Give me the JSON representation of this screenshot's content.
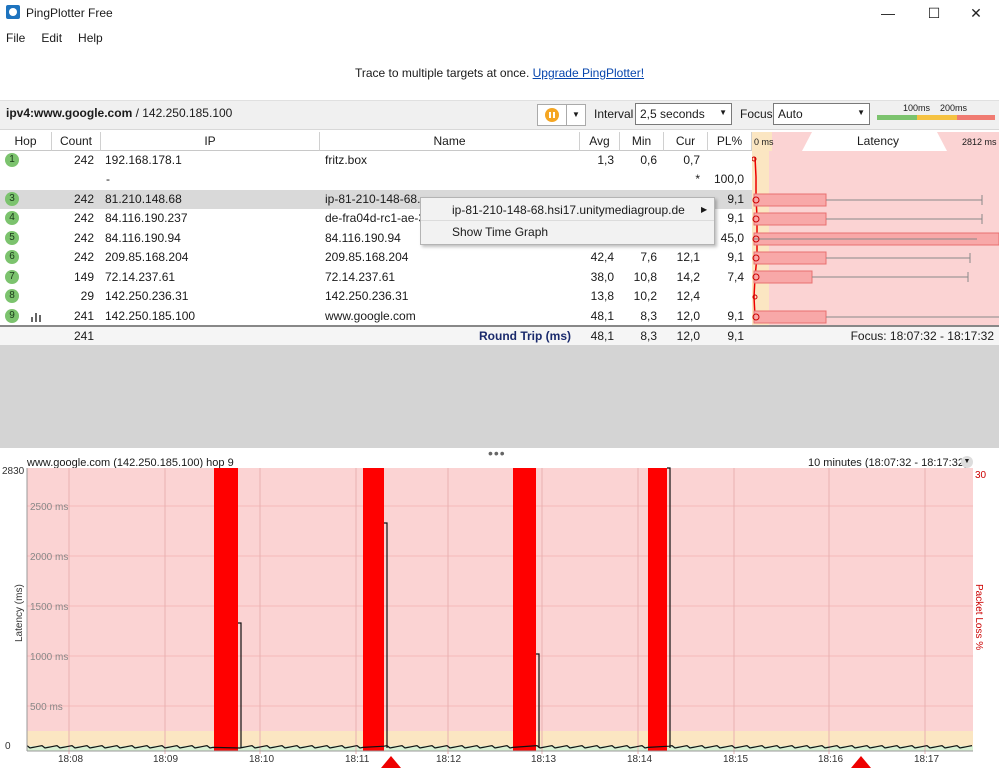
{
  "window": {
    "title": "PingPlotter Free",
    "minimize": "—",
    "maximize": "☐",
    "close": "✕"
  },
  "menu": [
    "File",
    "Edit",
    "Help"
  ],
  "promo": {
    "text": "Trace to multiple targets at once.",
    "link": "Upgrade PingPlotter!"
  },
  "toolbar": {
    "target_host": "ipv4:www.google.com",
    "target_sep": " / ",
    "target_ip": "142.250.185.100",
    "interval_label": "Interval",
    "interval_value": "2,5 seconds",
    "focus_label": "Focus",
    "focus_value": "Auto",
    "scale_100": "100ms",
    "scale_200": "200ms"
  },
  "columns": {
    "hop": "Hop",
    "count": "Count",
    "ip": "IP",
    "name": "Name",
    "avg": "Avg",
    "min": "Min",
    "cur": "Cur",
    "pl": "PL%",
    "lat_min": "0 ms",
    "latency": "Latency",
    "lat_max": "2812 ms"
  },
  "hops": [
    {
      "hop": "1",
      "count": "242",
      "ip": "192.168.178.1",
      "name": "fritz.box",
      "avg": "1,3",
      "min": "0,6",
      "cur": "0,7",
      "pl": ""
    },
    {
      "hop": "",
      "count": "-",
      "ip": "",
      "name": "",
      "avg": "",
      "min": "",
      "cur": "*",
      "pl": "100,0"
    },
    {
      "hop": "3",
      "count": "242",
      "ip": "81.210.148.68",
      "name": "ip-81-210-148-68.",
      "avg": "",
      "min": "",
      "cur": "",
      "pl": "9,1"
    },
    {
      "hop": "4",
      "count": "242",
      "ip": "84.116.190.237",
      "name": "de-fra04d-rc1-ae-3",
      "avg": "",
      "min": "",
      "cur": "",
      "pl": "9,1"
    },
    {
      "hop": "5",
      "count": "242",
      "ip": "84.116.190.94",
      "name": "84.116.190.94",
      "avg": "",
      "min": "",
      "cur": "",
      "pl": "45,0"
    },
    {
      "hop": "6",
      "count": "242",
      "ip": "209.85.168.204",
      "name": "209.85.168.204",
      "avg": "42,4",
      "min": "7,6",
      "cur": "12,1",
      "pl": "9,1"
    },
    {
      "hop": "7",
      "count": "149",
      "ip": "72.14.237.61",
      "name": "72.14.237.61",
      "avg": "38,0",
      "min": "10,8",
      "cur": "14,2",
      "pl": "7,4"
    },
    {
      "hop": "8",
      "count": "29",
      "ip": "142.250.236.31",
      "name": "142.250.236.31",
      "avg": "13,8",
      "min": "10,2",
      "cur": "12,4",
      "pl": ""
    },
    {
      "hop": "9",
      "count": "241",
      "ip": "142.250.185.100",
      "name": "www.google.com",
      "avg": "48,1",
      "min": "8,3",
      "cur": "12,0",
      "pl": "9,1"
    }
  ],
  "summary": {
    "count": "241",
    "label": "Round Trip (ms)",
    "avg": "48,1",
    "min": "8,3",
    "cur": "12,0",
    "pl": "9,1",
    "focus": "Focus: 18:07:32 - 18:17:32"
  },
  "context_menu": {
    "item1": "ip-81-210-148-68.hsi17.unitymediagroup.de",
    "item2": "Show Time Graph"
  },
  "graph": {
    "title": "www.google.com (142.250.185.100) hop 9",
    "range": "10 minutes (18:07:32 - 18:17:32)",
    "y_max": "2830",
    "y_zero": "0",
    "y_label": "Latency (ms)",
    "y2_label": "Packet Loss %",
    "y2_max": "30",
    "y_ticks": [
      "2500 ms",
      "2000 ms",
      "1500 ms",
      "1000 ms",
      "500 ms"
    ],
    "x_ticks": [
      "18:08",
      "18:09",
      "18:10",
      "18:11",
      "18:12",
      "18:13",
      "18:14",
      "18:15",
      "18:16",
      "18:17"
    ]
  },
  "colors": {
    "loss_bg": "#fbd3d3",
    "loss_bar": "#ff0000",
    "hop_green": "#7cc36e",
    "link": "#0645ad",
    "pause": "#f5a623"
  }
}
